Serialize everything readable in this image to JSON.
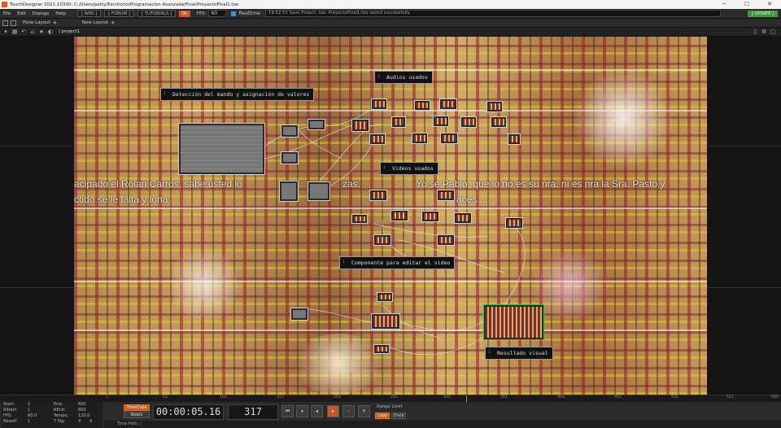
{
  "window": {
    "title": "TouchDesigner 2021.10330: C:/Users/patty/Escritorio/Programacion Avanzada/Final/ProyectoFinal1.toe",
    "minimize": "─",
    "maximize": "☐",
    "close": "✕"
  },
  "menu": {
    "items": [
      "File",
      "Edit",
      "Dialogs",
      "Help"
    ],
    "wiki": "[ WIKI ]",
    "forum": "[ FORUM ]",
    "tutorials": "[ TUTORIALS ]",
    "oc": "OC",
    "fps_label": "FPS:",
    "fps_value": "60",
    "realtime_label": "Realtime",
    "status": "19:52:53 Save Project .toe: ProyectoFinal1.toe saved successfully.",
    "update": "[ UPDATE ]"
  },
  "panebar": {
    "pane_layout": "Pane Layout",
    "new_layout": "New Layout",
    "plus": "+"
  },
  "pathbar": {
    "path": "/ project1"
  },
  "network": {
    "overlay_left": "acipado el Rolan Carros, sabe usted lo",
    "overlay_left2": "ctido se le falta y lona",
    "overlay_mid": "zas.",
    "overlay_right": "Yo se Pablo, que lo no es su nra. ni es nra la Sra. Pasto y",
    "overlay_right2": "aces...",
    "comments": [
      {
        "label": "Detección del mando y asignación de valores"
      },
      {
        "label": "Audios usados"
      },
      {
        "label": "Videos usados"
      },
      {
        "label": "Componente para editar el video"
      },
      {
        "label": "Resultado visual"
      }
    ]
  },
  "timeline": {
    "ticks": [
      "1",
      "51",
      "101",
      "151",
      "201",
      "251",
      "301",
      "351",
      "401",
      "451",
      "501",
      "551",
      "600"
    ]
  },
  "bottom": {
    "start_label": "Start:",
    "start": "1",
    "end_label": "End:",
    "end": "600",
    "rstart_label": "RStart:",
    "rstart": "1",
    "rend_label": "REnd:",
    "rend": "600",
    "fps_label": "FPS:",
    "fps": "60.0",
    "tempo_label": "Tempo:",
    "tempo": "120.0",
    "resetf_label": "ResetF:",
    "resetf": "1",
    "tsig_label": "T Sig:",
    "tsig_a": "4",
    "tsig_b": "4",
    "timecode": "TimeCode",
    "beats": "Beats",
    "time_display": "00:00:05.16",
    "frame_display": "317",
    "range_limit": "Range Limit",
    "loop": "Loop",
    "once": "Once",
    "time_path": "Time Path: /"
  },
  "colors": {
    "accent": "#c8581f",
    "update": "#3a9a3a",
    "selected": "#4db04d"
  }
}
